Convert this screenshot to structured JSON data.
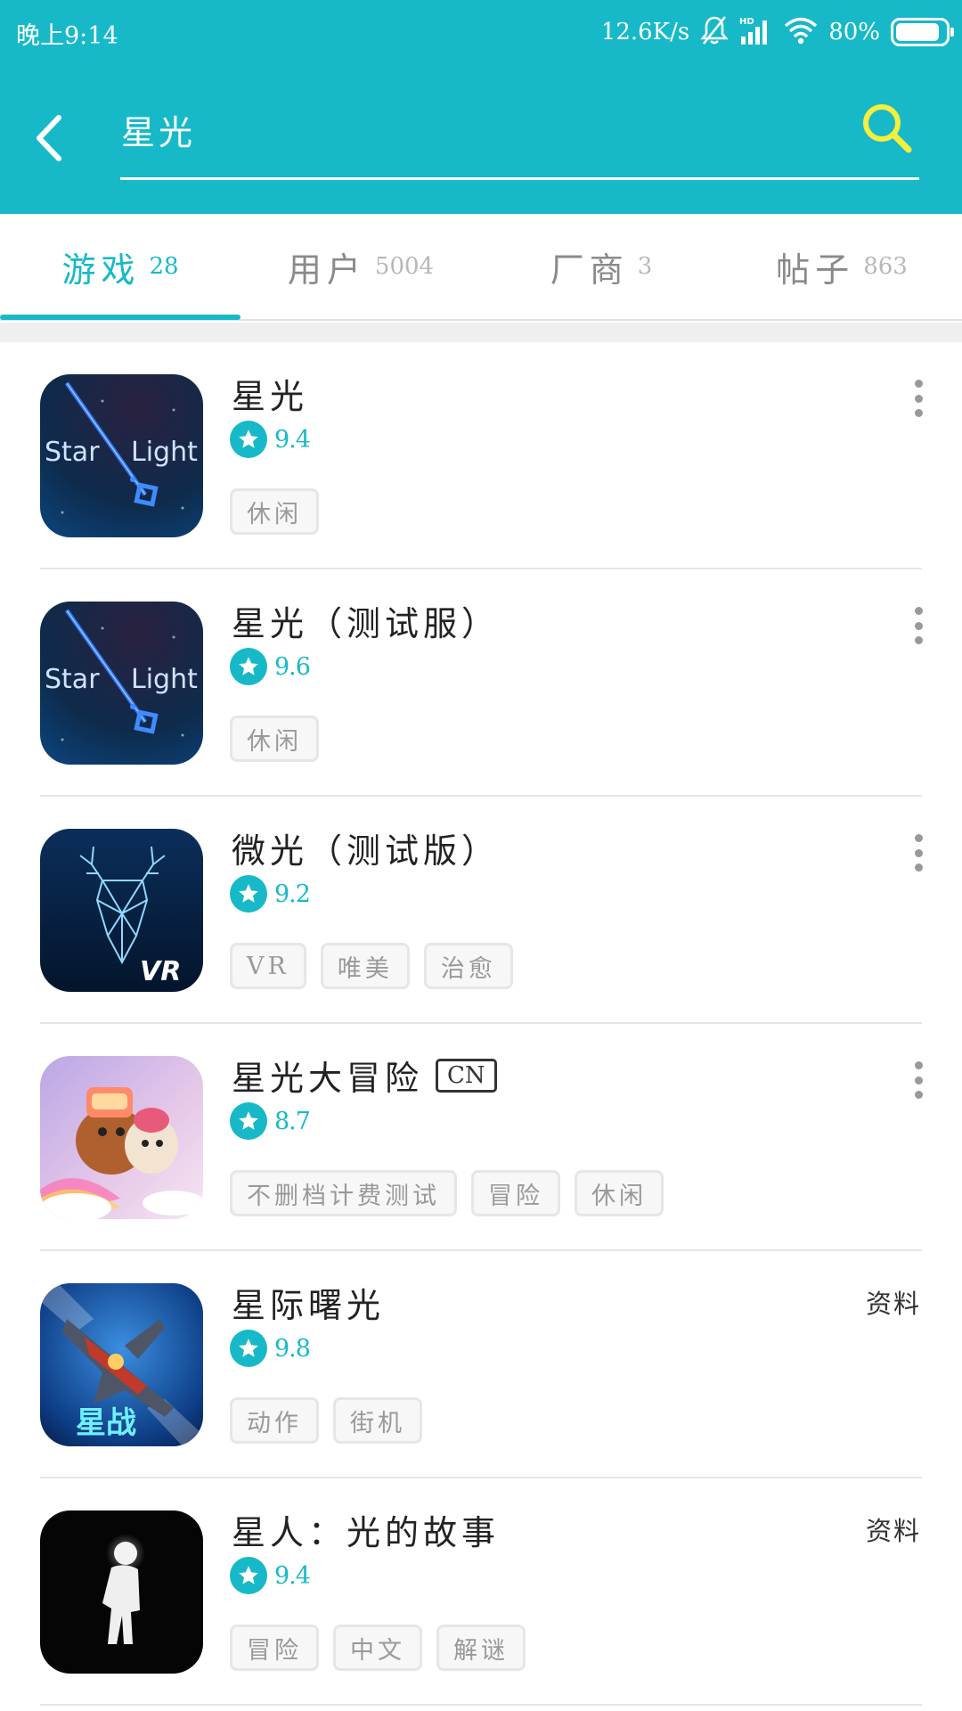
{
  "status_bar": {
    "time": "晚上9:14",
    "net_speed": "12.6K/s",
    "network_label": "HD",
    "battery": "80%"
  },
  "search": {
    "query": "星光"
  },
  "tabs": [
    {
      "label": "游戏",
      "count": "28",
      "active": true
    },
    {
      "label": "用户",
      "count": "5004",
      "active": false
    },
    {
      "label": "厂商",
      "count": "3",
      "active": false
    },
    {
      "label": "帖子",
      "count": "863",
      "active": false
    }
  ],
  "apps": [
    {
      "name": "星光",
      "rating": "9.4",
      "tags": [
        "休闲"
      ],
      "action": "more",
      "icon": "star-light-icon",
      "icon_text_left": "Star",
      "icon_text_right": "Light"
    },
    {
      "name": "星光（测试服）",
      "rating": "9.6",
      "tags": [
        "休闲"
      ],
      "action": "more",
      "icon": "star-light-icon",
      "icon_text_left": "Star",
      "icon_text_right": "Light"
    },
    {
      "name": "微光（测试版）",
      "rating": "9.2",
      "tags": [
        "VR",
        "唯美",
        "治愈"
      ],
      "action": "more",
      "icon": "neon-deer-icon",
      "icon_text": "VR"
    },
    {
      "name": "星光大冒险",
      "badge": "CN",
      "rating": "8.7",
      "tags": [
        "不删档计费测试",
        "冒险",
        "休闲"
      ],
      "action": "more",
      "icon": "adventure-characters-icon"
    },
    {
      "name": "星际曙光",
      "rating": "9.8",
      "tags": [
        "动作",
        "街机"
      ],
      "action": "资料",
      "icon": "space-fighter-icon",
      "icon_text": "星战"
    },
    {
      "name": "星人：光的故事",
      "rating": "9.4",
      "tags": [
        "冒险",
        "中文",
        "解谜"
      ],
      "action": "资料",
      "icon": "glowing-figure-icon"
    }
  ],
  "colors": {
    "accent": "#17b9c8",
    "search_icon": "#f5ee3c",
    "tag_text": "#999999"
  }
}
